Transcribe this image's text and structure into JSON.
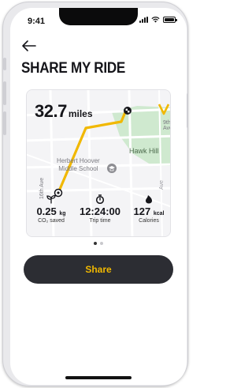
{
  "status_bar": {
    "time": "9:41"
  },
  "header": {
    "title": "SHARE MY RIDE"
  },
  "ride_card": {
    "distance_value": "32.7",
    "distance_unit": "miles",
    "map_labels": {
      "street_top": "9th Ave",
      "park": "Hawk Hill",
      "school_line1": "Herbert Hoover",
      "school_line2": "Middle School",
      "street_left": "16th Ave",
      "street_right": "Ave"
    },
    "stats": [
      {
        "icon": "leaf-icon",
        "value": "0.25",
        "unit": "kg",
        "label": "CO₂ saved"
      },
      {
        "icon": "stopwatch-icon",
        "value": "12:24:00",
        "unit": "",
        "label": "Trip time"
      },
      {
        "icon": "flame-icon",
        "value": "127",
        "unit": "kcal",
        "label": "Calories"
      }
    ]
  },
  "pagination": {
    "count": 2,
    "active_index": 0
  },
  "actions": {
    "share_label": "Share"
  },
  "colors": {
    "accent": "#f1b800",
    "button_bg": "#2c2d33",
    "route": "#f1b800",
    "park": "#cfe9cf"
  }
}
